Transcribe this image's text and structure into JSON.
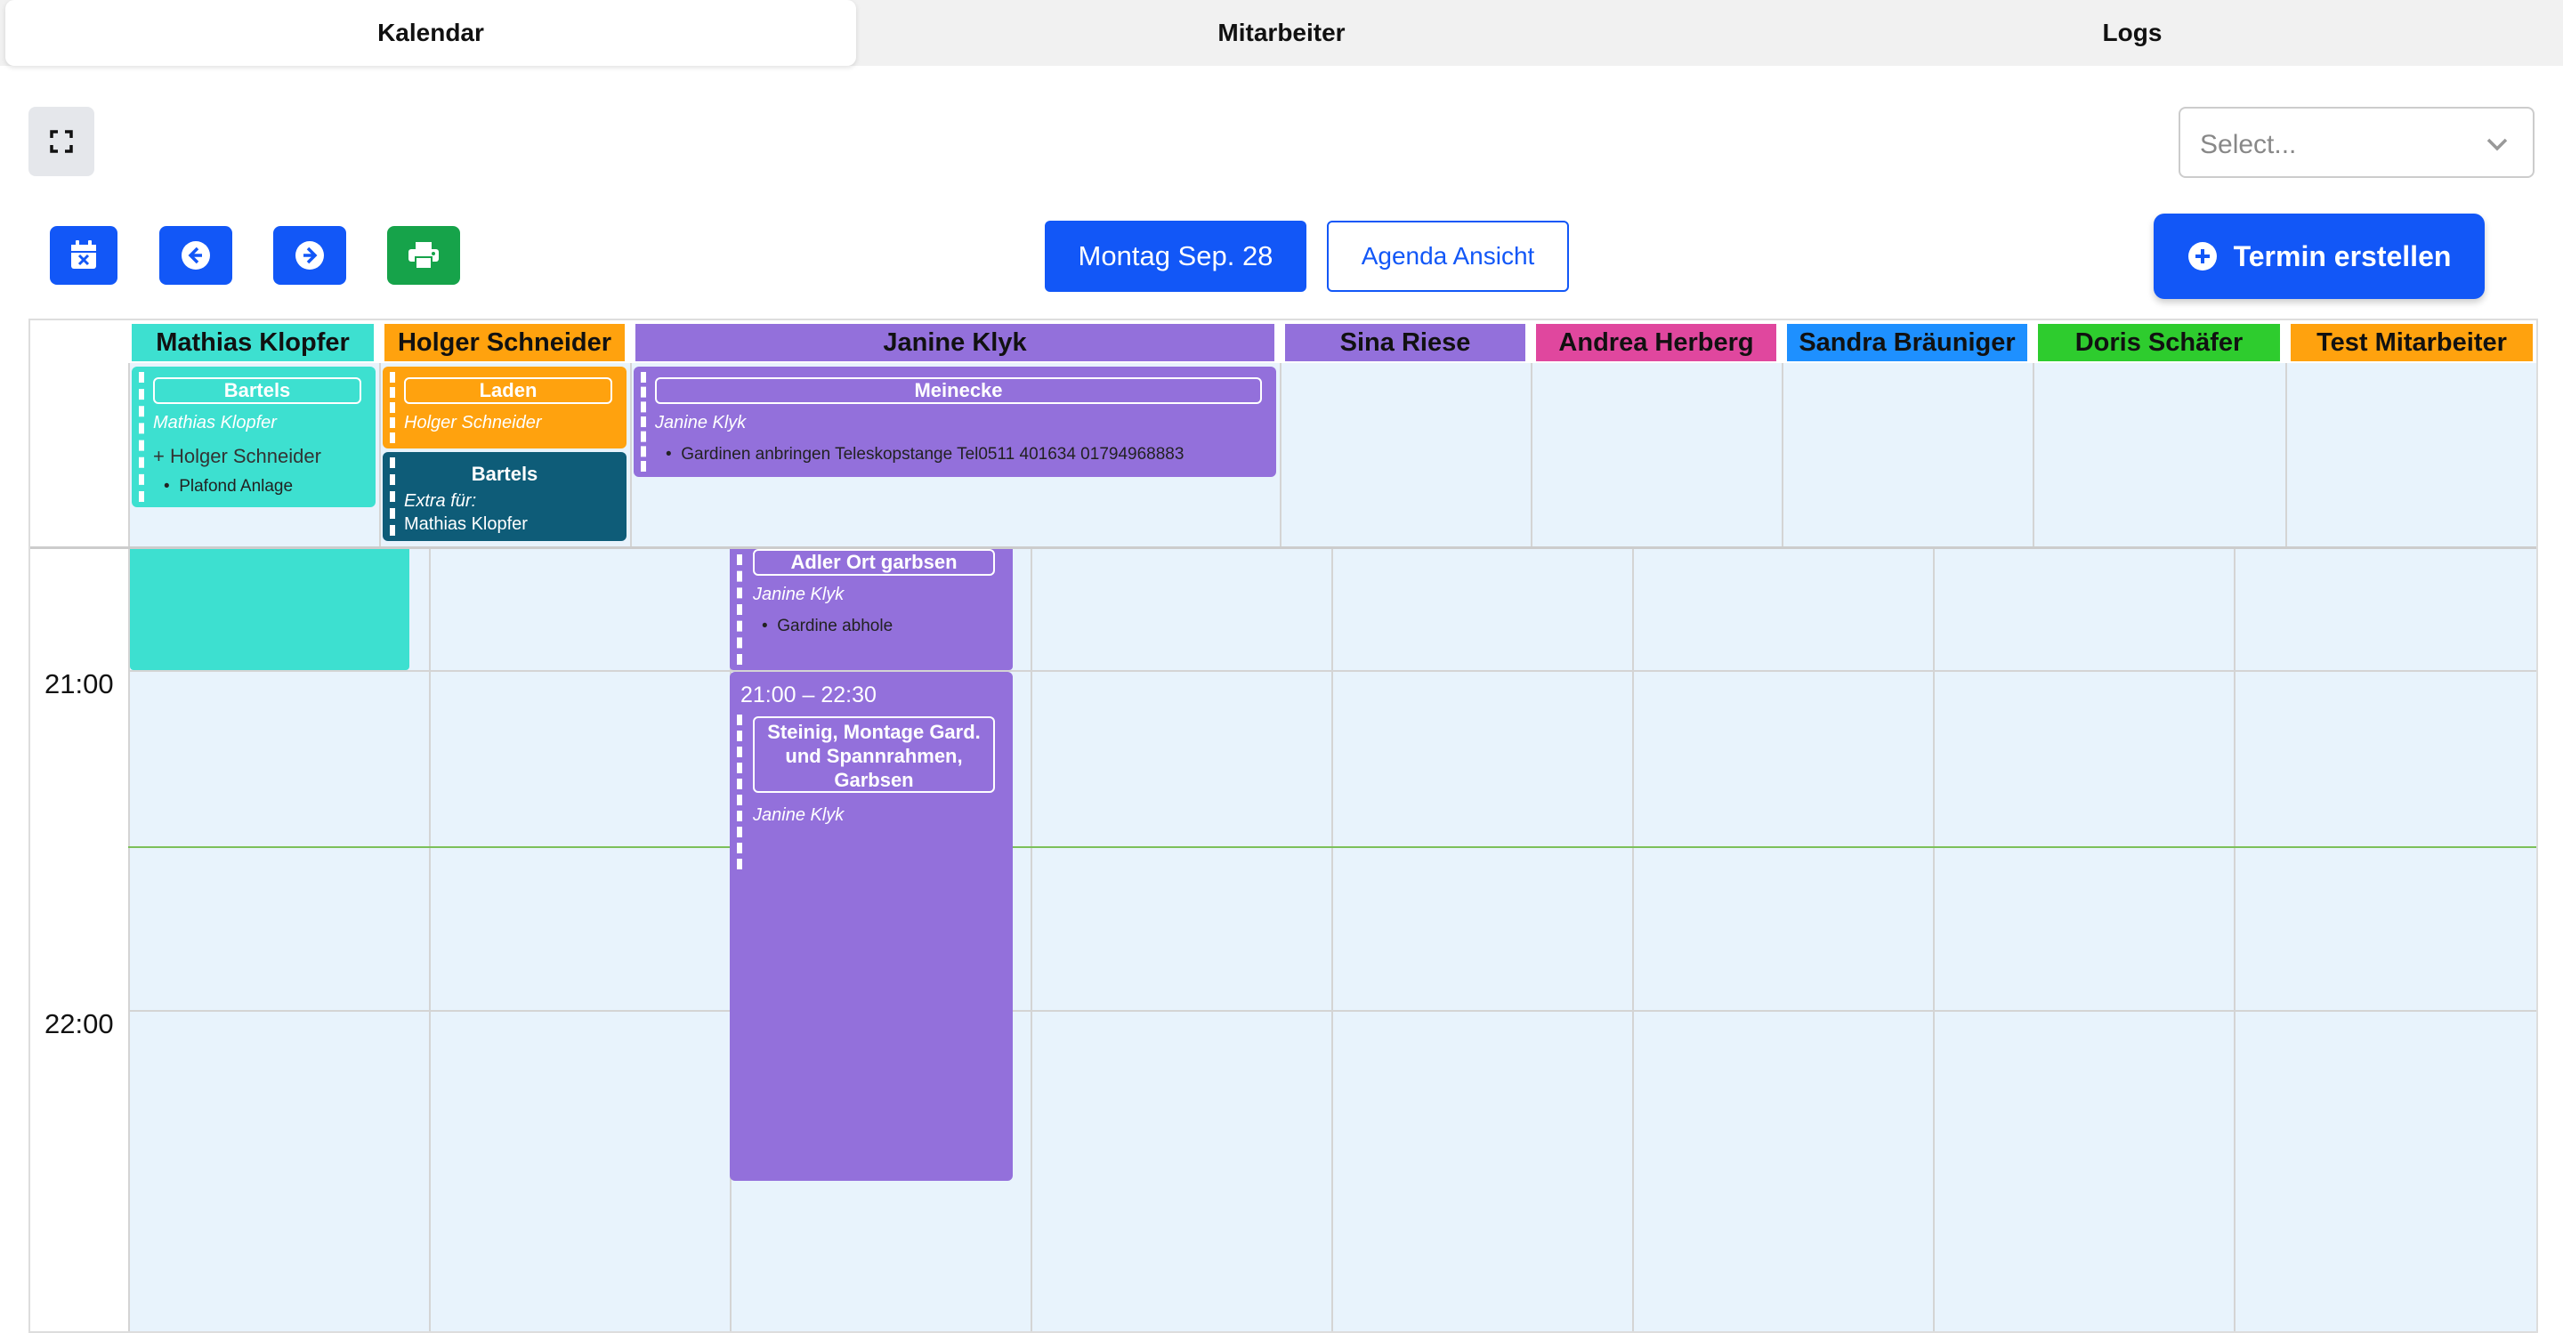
{
  "tabs": [
    "Kalendar",
    "Mitarbeiter",
    "Logs"
  ],
  "select": {
    "placeholder": "Select..."
  },
  "toolbar": {
    "today_label": "Montag Sep. 28",
    "agenda_label": "Agenda Ansicht",
    "create_label": "Termin erstellen"
  },
  "icons": {
    "fullscreen": "fullscreen-icon",
    "today": "calendar-x-icon",
    "prev": "arrow-left-circle-icon",
    "next": "arrow-right-circle-icon",
    "print": "printer-icon",
    "plus": "plus-circle-icon",
    "chevron": "chevron-down-icon"
  },
  "colors": {
    "primary": "#1257f7",
    "print": "#16a34a",
    "grid_bg": "#e8f3fc",
    "now_line": "#7cc05a"
  },
  "employees": [
    {
      "name": "Mathias Klopfer",
      "color": "#3de0d0"
    },
    {
      "name": "Holger Schneider",
      "color": "#ffa20e"
    },
    {
      "name": "Janine Klyk",
      "color": "#9370db"
    },
    {
      "name": "Sina Riese",
      "color": "#9370db"
    },
    {
      "name": "Andrea Herberg",
      "color": "#e0479e"
    },
    {
      "name": "Sandra Bräuniger",
      "color": "#1e90ff"
    },
    {
      "name": "Doris Schäfer",
      "color": "#2ecc2e"
    },
    {
      "name": "Test Mitarbeiter",
      "color": "#ffa20e"
    }
  ],
  "allday_events": [
    {
      "title": "Bartels",
      "person": "Mathias Klopfer",
      "extra_person": "+ Holger Schneider",
      "items": [
        "Plafond Anlage"
      ],
      "color": "#3de0d0"
    },
    {
      "title": "Laden",
      "person": "Holger Schneider",
      "color": "#ffa20e"
    },
    {
      "title": "Bartels",
      "extra_label": "Extra für:",
      "extra_name": "Mathias Klopfer",
      "color": "#0e5c78"
    },
    {
      "title": "Meinecke",
      "person": "Janine Klyk",
      "items": [
        "Gardinen anbringen Teleskopstange Tel0511 401634 01794968883"
      ],
      "color": "#9370db"
    }
  ],
  "times": [
    "21:00",
    "22:00"
  ],
  "timed_events": [
    {
      "title": "Adler Ort garbsen",
      "person": "Janine Klyk",
      "items": [
        "Gardine abhole"
      ],
      "color": "#9370db"
    },
    {
      "time": "21:00 – 22:30",
      "title_lines": [
        "Steinig, Montage Gard.",
        "und Spannrahmen,",
        "Garbsen"
      ],
      "person": "Janine Klyk",
      "color": "#9370db"
    }
  ]
}
